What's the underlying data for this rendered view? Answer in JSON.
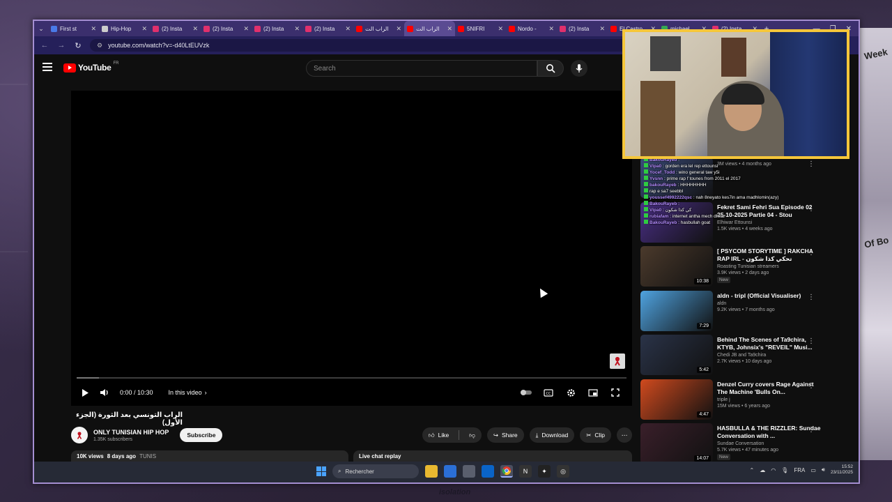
{
  "browser": {
    "tabs": [
      {
        "title": "First st",
        "color": "#4a7ae8"
      },
      {
        "title": "Hip-Hop",
        "color": "#cccccc"
      },
      {
        "title": "(2) Insta",
        "color": "#e1306c"
      },
      {
        "title": "(2) Insta",
        "color": "#e1306c"
      },
      {
        "title": "(2) Insta",
        "color": "#e1306c"
      },
      {
        "title": "(2) Insta",
        "color": "#e1306c"
      },
      {
        "title": "الراب الت",
        "color": "#ff0000"
      },
      {
        "title": "الراب الت",
        "color": "#ff0000",
        "active": true
      },
      {
        "title": "5NIFRI",
        "color": "#ff0000"
      },
      {
        "title": "Nordo -",
        "color": "#ff0000"
      },
      {
        "title": "(2) Insta",
        "color": "#e1306c"
      },
      {
        "title": "El Castro",
        "color": "#ff0000"
      },
      {
        "title": "michael",
        "color": "#34a853"
      },
      {
        "title": "(2) Insta",
        "color": "#e1306c"
      }
    ],
    "url": "youtube.com/watch?v=-d40LtEUVzk"
  },
  "youtube": {
    "logo_text": "YouTube",
    "country_code": "FR",
    "search_placeholder": "Search"
  },
  "player": {
    "time": "0:00 / 10:30",
    "in_this_video": "In this video",
    "progress_fraction": 0.0,
    "buffered_fraction": 0.04
  },
  "video": {
    "title": "الراب التونسي بعد الثورة (الجزء الأول)",
    "channel": "ONLY TUNISIAN HIP HOP",
    "subscribers": "1.35K subscribers",
    "subscribe_label": "Subscribe",
    "like_label": "Like",
    "share_label": "Share",
    "download_label": "Download",
    "clip_label": "Clip",
    "views": "10K views",
    "age": "8 days ago",
    "tag": "TUNIS",
    "live_chat": "Live chat replay"
  },
  "recommendations": [
    {
      "title": "",
      "channel": "",
      "meta": "3M views • 4 months ago",
      "duration": "",
      "color": "#3b4c7a",
      "new": false
    },
    {
      "title": "Fekret Sami Fehri Sua Episode 02 25-10-2025 Partie 04 - Stou",
      "channel": "Elhiwar Ettounsi",
      "meta": "1.5K views • 4 weeks ago",
      "duration": "",
      "color": "#4a2f86",
      "new": false
    },
    {
      "title": "[ PSYCOM STORYTIME ] RAKCHA RAP IRL - تحكي كذا شكون",
      "channel": "Roasting Tunisian streamers",
      "meta": "3.9K views • 2 days ago",
      "duration": "10:38",
      "color": "#4b3a2c",
      "new": true
    },
    {
      "title": "aldn - tripl (Official Visualiser)",
      "channel": "aldn",
      "meta": "9.2K views • 7 months ago",
      "duration": "7:29",
      "color": "#4fa3e0",
      "new": false
    },
    {
      "title": "Behind The Scenes of Ta9chira, KTYB, Johnsix's \"REVEIL\" Musi...",
      "channel": "Chedi JB and Ta9chira",
      "meta": "2.7K views • 10 days ago",
      "duration": "5:42",
      "color": "#2a3348",
      "new": false
    },
    {
      "title": "Denzel Curry covers Rage Against The Machine 'Bulls On...",
      "channel": "triple j",
      "meta": "15M views • 6 years ago",
      "duration": "4:47",
      "color": "#d04a1e",
      "new": false
    },
    {
      "title": "HASBULLA & THE RIZZLER: Sundae Conversation with ...",
      "channel": "Sundae Conversation",
      "meta": "5.7K views • 47 minutes ago",
      "duration": "14:07",
      "color": "#3a1f2a",
      "new": true
    }
  ],
  "chat": [
    {
      "user": "BakouRayeb",
      "msg": ""
    },
    {
      "user": "Vipa0",
      "msg": "gorden era lel rep ettounsi"
    },
    {
      "user": "Yocef_Todd",
      "msg": "wino general taw y5i"
    },
    {
      "user": "Yvsnn",
      "msg": "prime rap f tounes from 2011 el 2017"
    },
    {
      "user": "bakouRayeb",
      "msg": "HHHHHHHH"
    },
    {
      "user": "",
      "msg": "rap e sa7 seebbl"
    },
    {
      "user": "youssef4992222qsc",
      "msg": "nah 8neyato kes7in ama madhlomin(azy)"
    },
    {
      "user": "BakouRayeb",
      "msg": ""
    },
    {
      "user": "Vipa0",
      "msg": "كي كذا شكون"
    },
    {
      "user": "rubiafam",
      "msg": "internet antha mech dhkar"
    },
    {
      "user": "BakouRayeb",
      "msg": "hasbullah goat"
    }
  ],
  "taskbar": {
    "search_label": "Rechercher",
    "lang": "FRA",
    "time": "15:52",
    "date": "23/11/2025"
  },
  "overlay": {
    "bottom_text": "isolation",
    "right_poster_words": [
      "Week",
      "Of Bo"
    ]
  },
  "colors": {
    "accent": "#ff0000",
    "webcam_frame": "#f5c63a",
    "browser_border": "#a58fd2",
    "chat_username": "#b48cff"
  }
}
